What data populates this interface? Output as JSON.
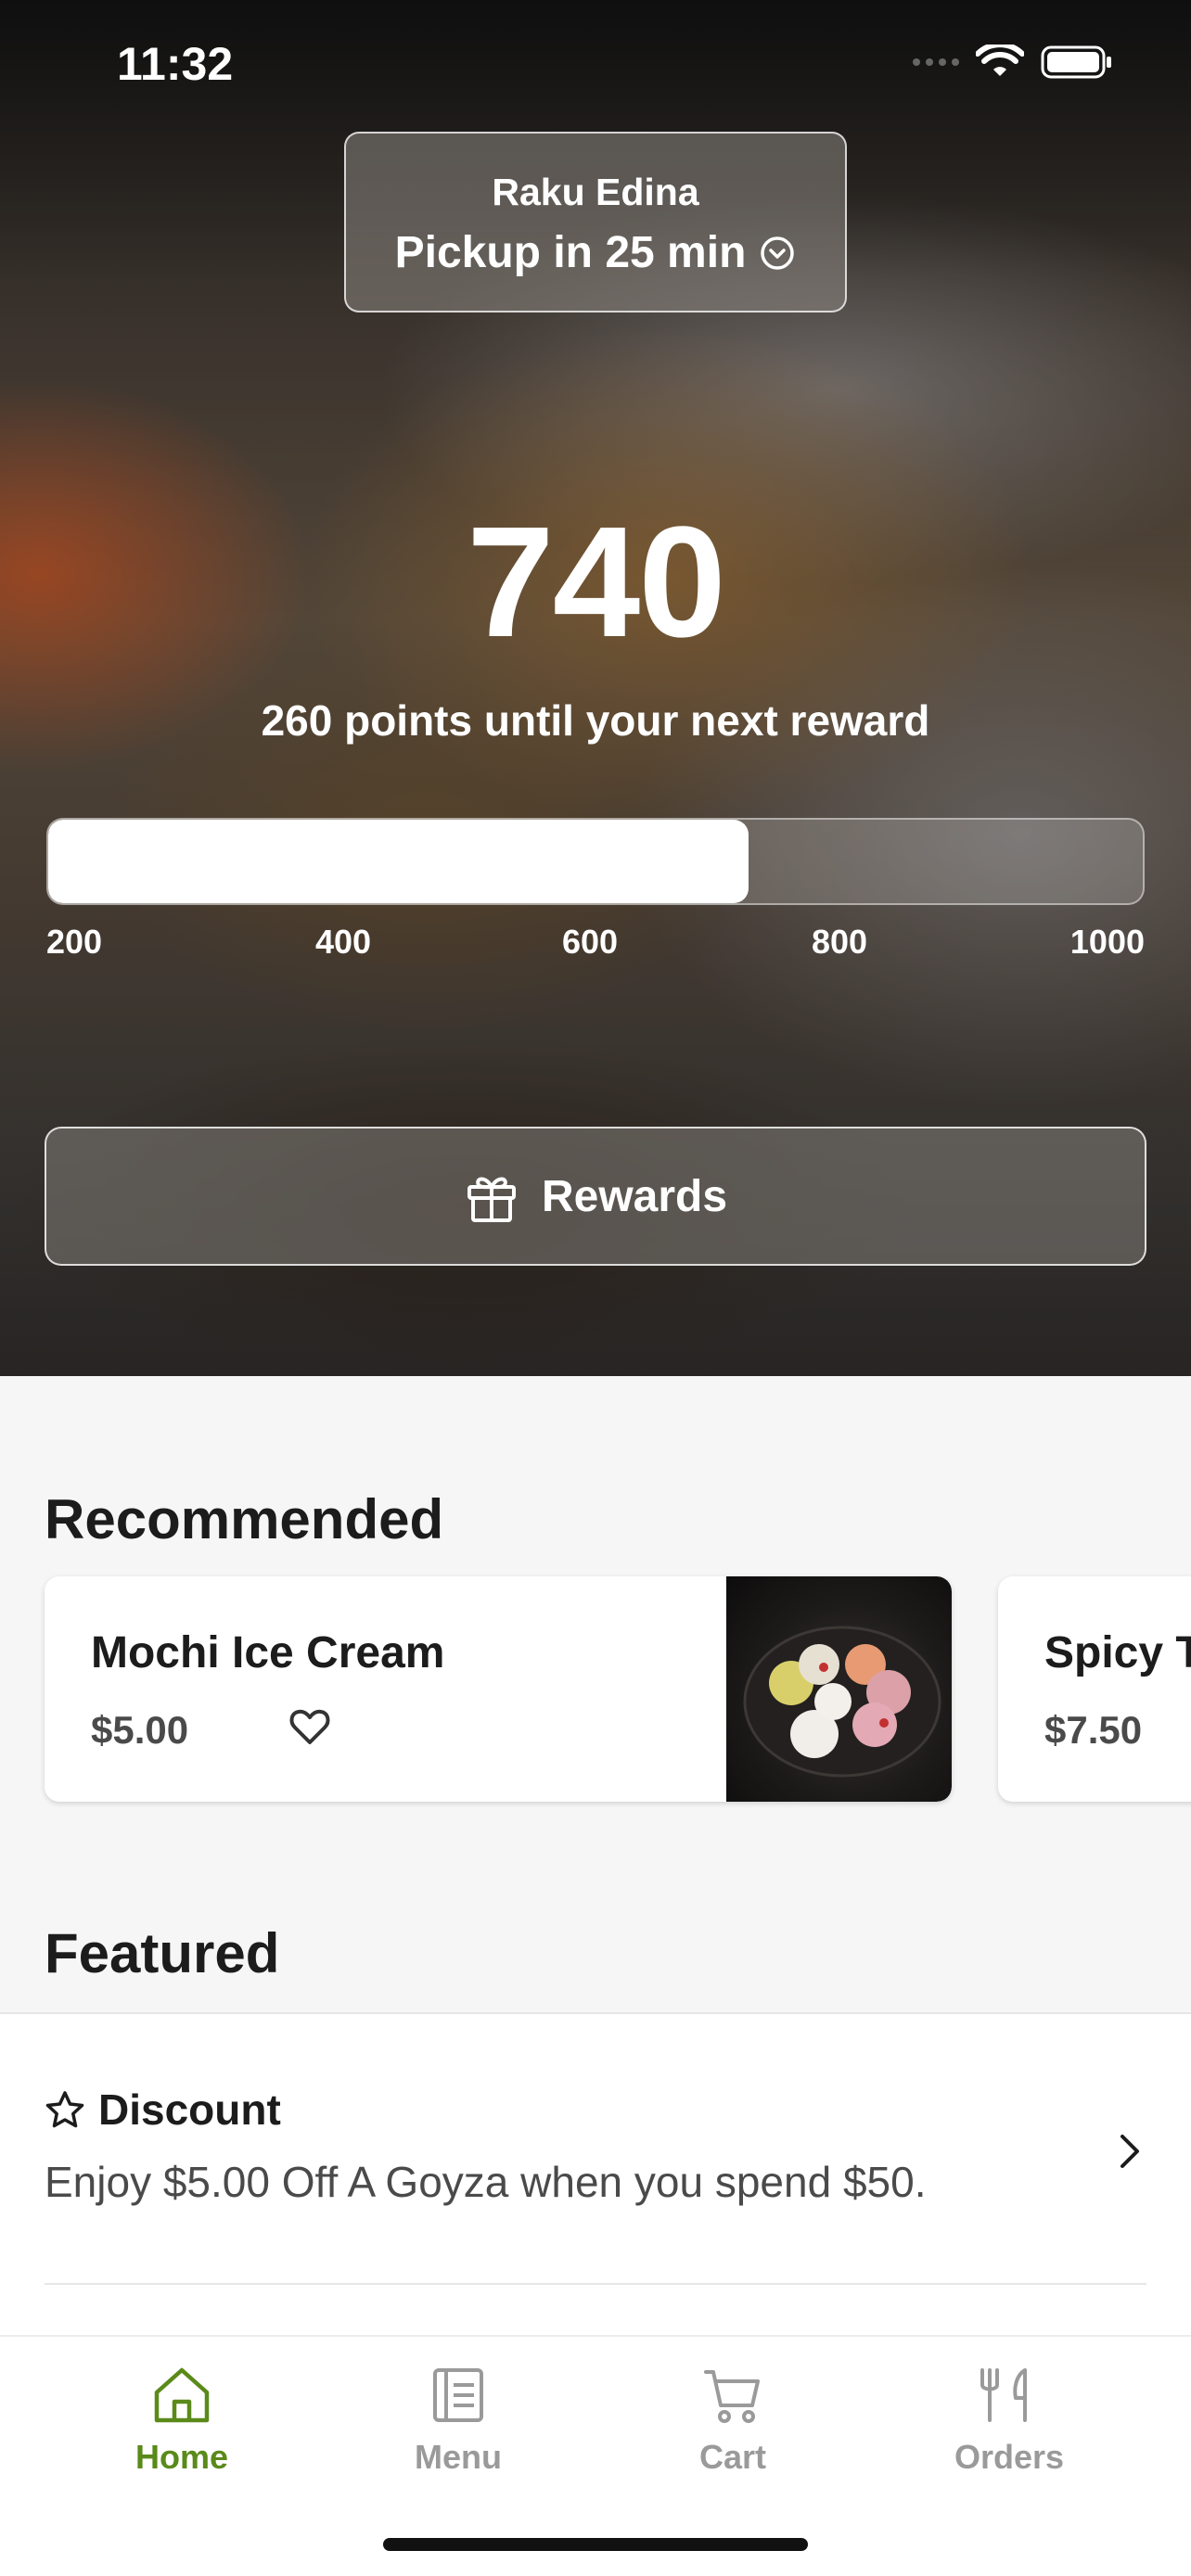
{
  "status_bar": {
    "time": "11:32"
  },
  "store": {
    "name": "Raku Edina",
    "pickup": "Pickup in 25 min"
  },
  "points": {
    "current": "740",
    "subtitle": "260 points until your next reward",
    "progress_percent": 64,
    "scale_labels": [
      "200",
      "400",
      "600",
      "800",
      "1000"
    ]
  },
  "rewards_button": {
    "label": "Rewards"
  },
  "recommended": {
    "title": "Recommended",
    "items": [
      {
        "name": "Mochi Ice Cream",
        "price": "$5.00"
      },
      {
        "name": "Spicy T",
        "price": "$7.50"
      }
    ]
  },
  "featured": {
    "title": "Featured",
    "items": [
      {
        "title": "Discount",
        "description": "Enjoy $5.00 Off A Goyza when you spend $50."
      }
    ]
  },
  "tab_bar": {
    "active_color": "#5a8a1a",
    "tabs": [
      {
        "label": "Home",
        "icon": "home-icon",
        "active": true
      },
      {
        "label": "Menu",
        "icon": "menu-icon",
        "active": false
      },
      {
        "label": "Cart",
        "icon": "cart-icon",
        "active": false
      },
      {
        "label": "Orders",
        "icon": "orders-icon",
        "active": false
      }
    ]
  }
}
